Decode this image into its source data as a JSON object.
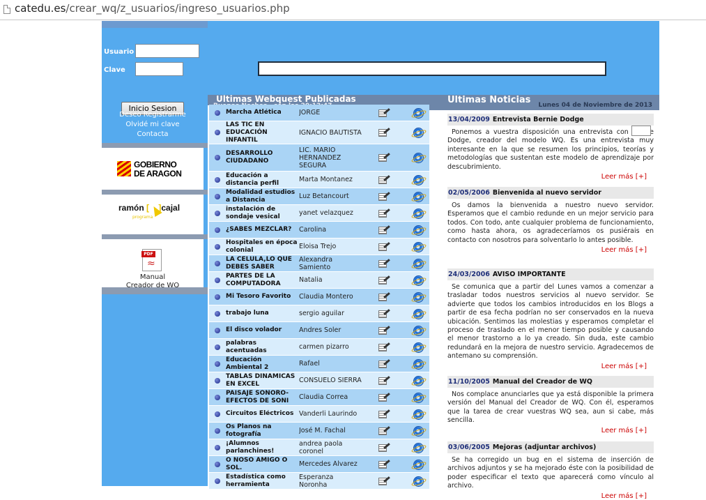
{
  "browser": {
    "url_domain": "catedu.es",
    "url_path": "/crear_wq/z_usuarios/ingreso_usuarios.php"
  },
  "login": {
    "user_label": "Usuario",
    "password_label": "Clave",
    "user_value": "",
    "password_value": "",
    "submit_label": "Inicio Sesion",
    "register_link": "Deseo Registrarme",
    "forgot_link": "Olvidé mi clave",
    "contact_link": "Contacta"
  },
  "sidebar": {
    "aragon_logo_line1": "GOBIERNO",
    "aragon_logo_line2": "DE ARAGON",
    "ramon_logo_word1": "ramón",
    "ramon_logo_word2": "cajal",
    "ramon_logo_sub": "programa",
    "manual_pdf_tag": "PDF",
    "manual_line1": "Manual",
    "manual_line2": "Creador de WQ"
  },
  "webquests": {
    "title": "Ultimas Webquest Publicadas",
    "greeting": "Buenas Noches , son las 20:12:47",
    "items": [
      {
        "title": "Marcha Atlética",
        "author": "JORGE"
      },
      {
        "title": "LAS TIC EN EDUCACIÓN INFANTIL",
        "author": "IGNACIO BAUTISTA"
      },
      {
        "title": "DESARROLLO CIUDADANO",
        "author": "LIC. MARIO HERNANDEZ SEGURA"
      },
      {
        "title": "Educación a distancia perfil",
        "author": "Marta Montanez"
      },
      {
        "title": "Modalidad estudios a Distancia",
        "author": "Luz Betancourt"
      },
      {
        "title": "instalación de sondaje vesical",
        "author": "yanet velazquez"
      },
      {
        "title": "¿SABES MEZCLAR?",
        "author": "Carolina"
      },
      {
        "title": "Hospitales en época colonial",
        "author": "Eloisa Trejo"
      },
      {
        "title": "LA CÉLULA,LO QUE DEBES SABER",
        "author": "Alexandra Samiento"
      },
      {
        "title": "PARTES DE LA COMPUTADORA",
        "author": "Natalia"
      },
      {
        "title": "Mi Tesoro Favorito",
        "author": "Claudia Montero"
      },
      {
        "title": "trabajo luna",
        "author": "sergio aguilar"
      },
      {
        "title": "El disco volador",
        "author": "Andres Soler"
      },
      {
        "title": "palabras acentuadas",
        "author": "carmen pizarro"
      },
      {
        "title": "Educación Ambiental 2",
        "author": "Rafael"
      },
      {
        "title": "TABLAS DINAMICAS EN EXCEL",
        "author": "CONSUELO SIERRA"
      },
      {
        "title": "PAISAJE SONORO-EFECTOS DE SONI",
        "author": "Claudia Correa"
      },
      {
        "title": "Circuitos Eléctricos",
        "author": "Vanderli Laurindo"
      },
      {
        "title": "Os Planos na fotografía",
        "author": "José M. Fachal"
      },
      {
        "title": "¡Alumnos parlanchines!",
        "author": "andrea paola coronel"
      },
      {
        "title": "O NOSO AMIGO O SOL.",
        "author": "Mercedes Álvarez"
      },
      {
        "title": "Estadística como herramienta",
        "author": "Esperanza Noronha"
      }
    ]
  },
  "news": {
    "title": "Ultimas Noticias",
    "date": "Lunes 04 de Noviembre de 2013",
    "more_label": "Leer más [+]",
    "items": [
      {
        "date": "13/04/2009",
        "headline": "Entrevista Bernie Dodge",
        "body": "Ponemos a vuestra disposición una entrevista con Bernie Dodge, creador del modelo WQ. Es una entrevista muy interesante en la que se resumen los principios, teorías y metodologías que sustentan este modelo de aprendizaje por descubrimiento."
      },
      {
        "date": "02/05/2006",
        "headline": "Bienvenida al nuevo servidor",
        "body": "Os damos la bienvenida a nuestro nuevo servidor. Esperamos que el cambio redunde en un mejor servicio para todos. Con todo, ante cualquier problema de funcionamiento, como hasta ahora, os agradeceríamos os pusiérais en contacto con nosotros para solventarlo lo antes posible."
      },
      {
        "date": "24/03/2006",
        "headline": "AVISO IMPORTANTE",
        "body": "Se comunica que a partir del Lunes vamos a comenzar a trasladar todos nuestros servicios al nuevo servidor. Se advierte que todos los cambios introducidos en los Blogs a partir de esa fecha podrían no ser conservados en la nueva ubicación. Sentimos las molestias y esperamos completar el proceso de traslado en el menor tiempo posible y causando el menor trastorno a lo ya creado. Sin duda, este cambio redundará en la mejora de nuestro servicio. Agradecemos de antemano su comprensión."
      },
      {
        "date": "11/10/2005",
        "headline": "Manual del Creador de WQ",
        "body": "Nos complace anunciarles que ya está disponible la primera versión del Manual del Creador de WQ. Con él, esperamos que la tarea de crear vuestras WQ sea, aun si cabe, más sencilla."
      },
      {
        "date": "03/06/2005",
        "headline": "Mejoras (adjuntar archivos)",
        "body": "Se ha corregido un bug en el sistema de inserción de archivos adjuntos y se ha mejorado éste con la posibilidad de poder especificar el texto que aparecerá como vínculo al archivo."
      }
    ]
  }
}
